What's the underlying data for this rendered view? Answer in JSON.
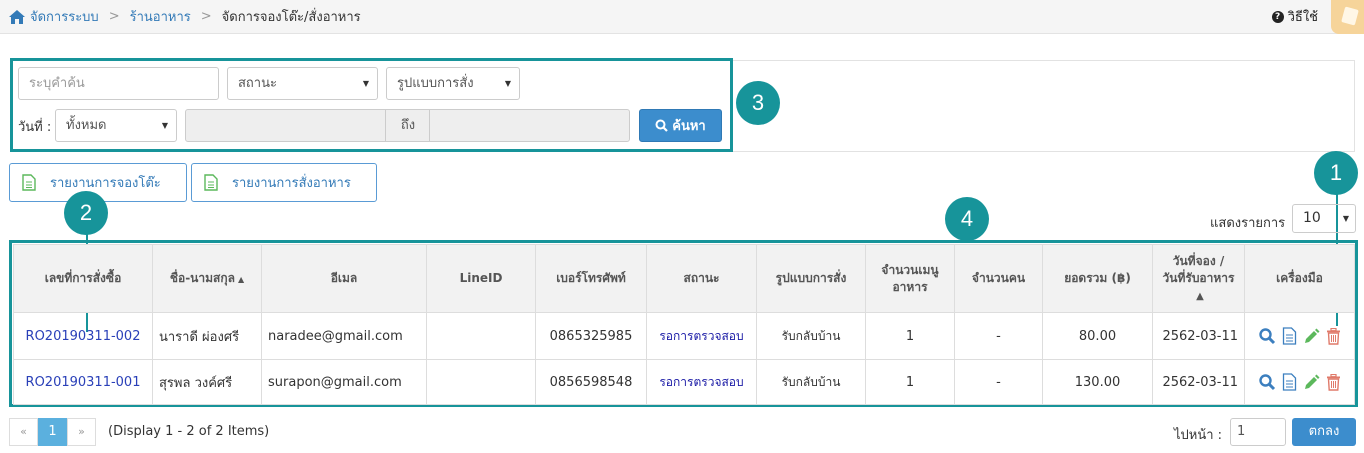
{
  "breadcrumb": {
    "home": "จัดการระบบ",
    "section": "ร้านอาหาร",
    "current": "จัดการจองโต๊ะ/สั่งอาหาร"
  },
  "help": {
    "label": "วิธีใช้"
  },
  "filters": {
    "search_placeholder": "ระบุคำค้น",
    "status_select": "สถานะ",
    "order_type_select": "รูปแบบการสั่ง",
    "date_label": "วันที่ :",
    "date_range_select": "ทั้งหมด",
    "date_to_label": "ถึง",
    "search_button": "ค้นหา"
  },
  "reports": {
    "table_booking": "รายงานการจองโต๊ะ",
    "food_order": "รายงานการสั่งอาหาร"
  },
  "page_size": {
    "label": "แสดงรายการ",
    "value": "10"
  },
  "callouts": [
    "1",
    "2",
    "3",
    "4"
  ],
  "table": {
    "headers": {
      "order_no": "เลขที่การสั่งซื้อ",
      "name": "ชื่อ-นามสกุล",
      "email": "อีเมล",
      "line_id": "LineID",
      "phone": "เบอร์โทรศัพท์",
      "status": "สถานะ",
      "order_type": "รูปแบบการสั่ง",
      "menu_count_1": "จำนวนเมนู",
      "menu_count_2": "อาหาร",
      "people": "จำนวนคน",
      "total": "ยอดรวม (฿)",
      "date_1": "วันที่จอง /",
      "date_2": "วันที่รับอาหาร",
      "tools": "เครื่องมือ"
    },
    "rows": [
      {
        "order_no": "RO20190311-002",
        "name": "นาราดี ผ่องศรี",
        "email": "naradee@gmail.com",
        "line_id": "",
        "phone": "0865325985",
        "status": "รอการตรวจสอบ",
        "order_type": "รับกลับบ้าน",
        "menu_count": "1",
        "people": "-",
        "total": "80.00",
        "date": "2562-03-11"
      },
      {
        "order_no": "RO20190311-001",
        "name": "สุรพล วงค์ศรี",
        "email": "surapon@gmail.com",
        "line_id": "",
        "phone": "0856598548",
        "status": "รอการตรวจสอบ",
        "order_type": "รับกลับบ้าน",
        "menu_count": "1",
        "people": "-",
        "total": "130.00",
        "date": "2562-03-11"
      }
    ]
  },
  "pagination": {
    "prev": "«",
    "page": "1",
    "next": "»",
    "info": "(Display 1 - 2 of 2 Items)",
    "goto_label": "ไปหน้า :",
    "goto_value": "1",
    "goto_button": "ตกลง"
  },
  "colors": {
    "accent": "#17949a",
    "primary": "#3c8dcd",
    "link": "#2a40b8",
    "delete": "#e07a6a",
    "edit": "#5cb85c"
  }
}
